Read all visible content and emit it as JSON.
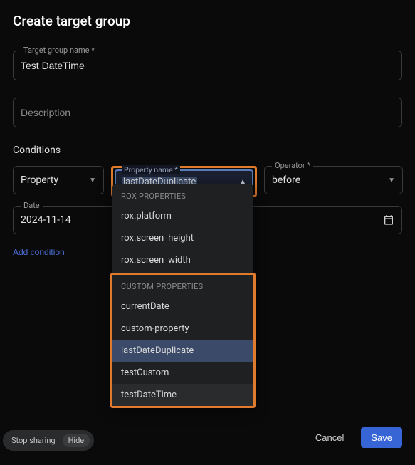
{
  "title": "Create target group",
  "fields": {
    "name_label": "Target group name *",
    "name_value": "Test DateTime",
    "desc_placeholder": "Description"
  },
  "conditions": {
    "label": "Conditions",
    "col1": {
      "value": "Property"
    },
    "col2": {
      "label": "Property name *",
      "value": "lastDateDuplicate"
    },
    "col3": {
      "label": "Operator *",
      "value": "before"
    },
    "date": {
      "label": "Date",
      "value": "2024-11-14"
    },
    "add": "Add condition"
  },
  "dropdown": {
    "sec1_header": "ROX PROPERTIES",
    "sec1_items": [
      "rox.platform",
      "rox.screen_height",
      "rox.screen_width"
    ],
    "sec2_header": "CUSTOM PROPERTIES",
    "sec2_items": [
      "currentDate",
      "custom-property",
      "lastDateDuplicate",
      "testCustom",
      "testDateTime"
    ],
    "selected": "lastDateDuplicate"
  },
  "footer": {
    "cancel": "Cancel",
    "save": "Save"
  },
  "share": {
    "stop": "Stop sharing",
    "hide": "Hide"
  }
}
